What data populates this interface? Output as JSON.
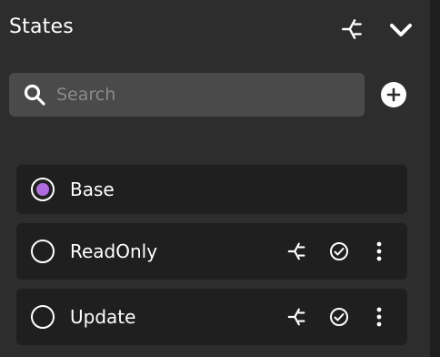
{
  "panel": {
    "title": "States",
    "header_icons": [
      "branch-icon",
      "chevron-down-icon"
    ]
  },
  "search": {
    "placeholder": "Search",
    "value": ""
  },
  "add_icon": "plus-circle-icon",
  "states": [
    {
      "label": "Base",
      "selected": true,
      "actions": []
    },
    {
      "label": "ReadOnly",
      "selected": false,
      "actions": [
        "branch-icon",
        "check-circle-icon",
        "more-vertical-icon"
      ]
    },
    {
      "label": "Update",
      "selected": false,
      "actions": [
        "branch-icon",
        "check-circle-icon",
        "more-vertical-icon"
      ]
    }
  ],
  "colors": {
    "panel_background": "#2d2d2d",
    "row_background": "#1f1f1f",
    "search_background": "#4a4a4a",
    "selected_accent": "#b06cdf",
    "text": "#ffffff",
    "placeholder": "#8a8a8a"
  }
}
